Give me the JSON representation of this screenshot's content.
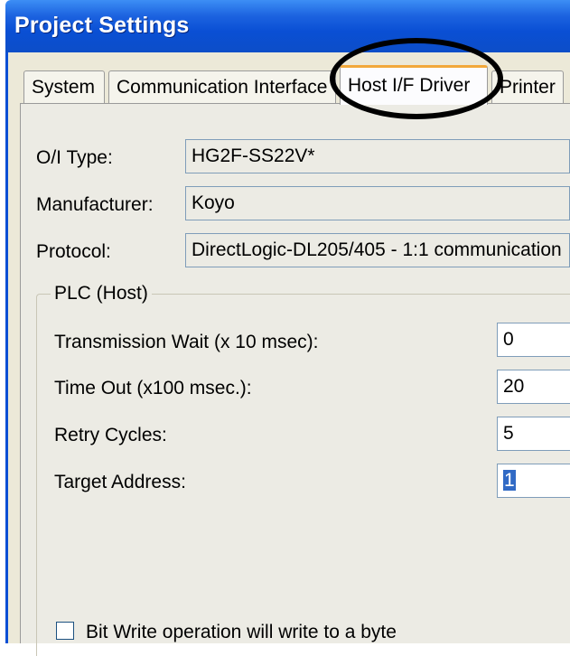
{
  "window": {
    "title": "Project Settings"
  },
  "tabs": [
    {
      "label": "System"
    },
    {
      "label": "Communication Interface"
    },
    {
      "label": "Host I/F Driver"
    },
    {
      "label": "Printer"
    }
  ],
  "fields": {
    "oi_type": {
      "label": "O/I Type:",
      "value": "HG2F-SS22V*"
    },
    "manufacturer": {
      "label": "Manufacturer:",
      "value": "Koyo"
    },
    "protocol": {
      "label": "Protocol:",
      "value": "DirectLogic-DL205/405 - 1:1 communication"
    }
  },
  "plc_group": {
    "title": "PLC (Host)",
    "transmission_wait": {
      "label": "Transmission Wait (x 10 msec):",
      "value": "0"
    },
    "time_out": {
      "label": "Time Out (x100 msec.):",
      "value": "20"
    },
    "retry_cycles": {
      "label": "Retry Cycles:",
      "value": "5"
    },
    "target_address": {
      "label": "Target Address:",
      "value": "1"
    }
  },
  "bit_write": {
    "label": "Bit Write operation will write to a byte",
    "checked": false
  }
}
